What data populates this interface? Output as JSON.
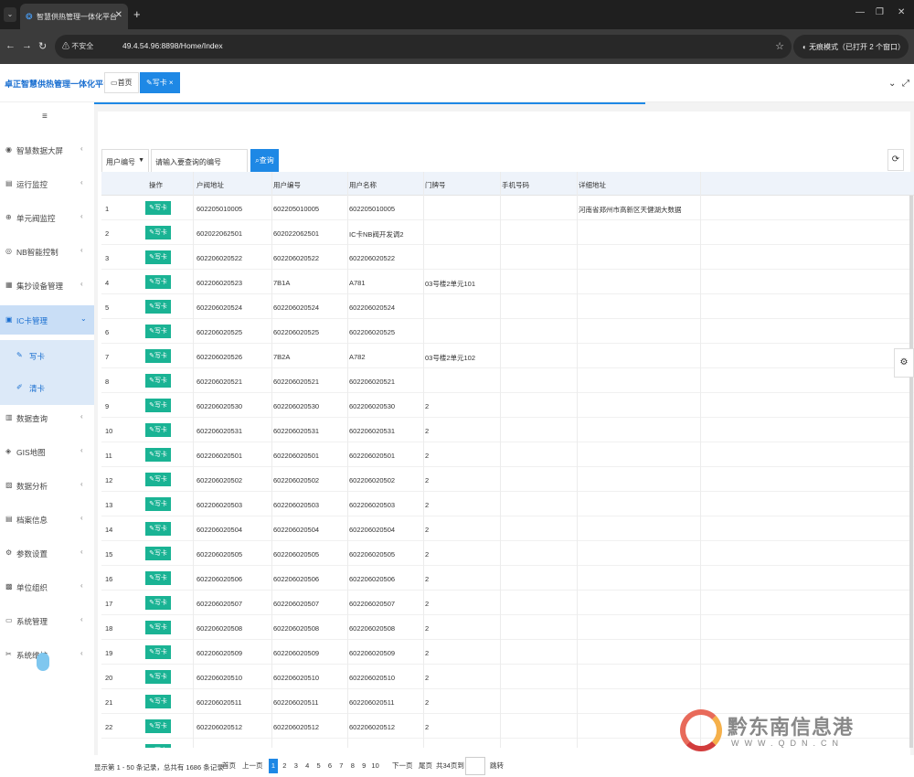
{
  "browser": {
    "tab_title": "智慧供热管理一体化平台",
    "tab_close": "✕",
    "new_tab": "+",
    "insecure_label": "不安全",
    "url": "49.4.54.96:8898/Home/Index",
    "incognito_label": "无痕模式（已打开 2 个窗口）",
    "win_min": "—",
    "win_restore": "❐",
    "win_close": "✕"
  },
  "app": {
    "brand": "卓正智慧供热管理一体化平台",
    "tabs": [
      {
        "label": "首页"
      },
      {
        "label": "写卡 ×"
      }
    ]
  },
  "sidebar": {
    "toggle": "≡",
    "items": [
      {
        "icon": "dashboard-icon",
        "glyph": "◉",
        "label": "智慧数据大屏"
      },
      {
        "icon": "monitor-icon",
        "glyph": "▤",
        "label": "运行监控"
      },
      {
        "icon": "unit-monitor-icon",
        "glyph": "⊕",
        "label": "单元阀监控"
      },
      {
        "icon": "nb-control-icon",
        "glyph": "◎",
        "label": "NB智能控制"
      },
      {
        "icon": "concentrator-icon",
        "glyph": "▦",
        "label": "集抄设备管理"
      },
      {
        "icon": "ic-card-icon",
        "glyph": "▣",
        "label": "IC卡管理"
      },
      {
        "icon": "data-query-icon",
        "glyph": "▥",
        "label": "数据查询"
      },
      {
        "icon": "gis-map-icon",
        "glyph": "◈",
        "label": "GIS地图"
      },
      {
        "icon": "data-analysis-icon",
        "glyph": "▨",
        "label": "数据分析"
      },
      {
        "icon": "archive-icon",
        "glyph": "▤",
        "label": "档案信息"
      },
      {
        "icon": "parameter-settings-icon",
        "glyph": "⚙",
        "label": "参数设置"
      },
      {
        "icon": "organization-icon",
        "glyph": "▩",
        "label": "单位组织"
      },
      {
        "icon": "system-management-icon",
        "glyph": "▭",
        "label": "系统管理"
      },
      {
        "icon": "system-maintenance-icon",
        "glyph": "✂",
        "label": "系统维护"
      }
    ],
    "sub_items": [
      {
        "icon": "write-card-icon",
        "glyph": "✎",
        "label": "写卡"
      },
      {
        "icon": "clear-card-icon",
        "glyph": "✐",
        "label": "清卡"
      }
    ]
  },
  "search": {
    "field_select": "用户编号",
    "placeholder": "请输入要查询的编号",
    "button": "查询",
    "refresh": "⟳"
  },
  "table": {
    "headers": [
      "",
      "操作",
      "户阀地址",
      "用户编号",
      "用户名称",
      "门牌号",
      "手机号码",
      "详细地址"
    ],
    "action_label": "写卡",
    "rows": [
      [
        "1",
        "602205010005",
        "602205010005",
        "602205010005",
        "",
        "",
        "河南省郑州市高新区天健湖大数据"
      ],
      [
        "2",
        "602022062501",
        "602022062501",
        "IC卡NB阀开发调2",
        "",
        "",
        ""
      ],
      [
        "3",
        "602206020522",
        "602206020522",
        "602206020522",
        "",
        "",
        ""
      ],
      [
        "4",
        "602206020523",
        "7B1A",
        "A781",
        "03号楼2单元101",
        "",
        ""
      ],
      [
        "5",
        "602206020524",
        "602206020524",
        "602206020524",
        "",
        "",
        ""
      ],
      [
        "6",
        "602206020525",
        "602206020525",
        "602206020525",
        "",
        "",
        ""
      ],
      [
        "7",
        "602206020526",
        "7B2A",
        "A782",
        "03号楼2单元102",
        "",
        ""
      ],
      [
        "8",
        "602206020521",
        "602206020521",
        "602206020521",
        "",
        "",
        ""
      ],
      [
        "9",
        "602206020530",
        "602206020530",
        "602206020530",
        "2",
        "",
        ""
      ],
      [
        "10",
        "602206020531",
        "602206020531",
        "602206020531",
        "2",
        "",
        ""
      ],
      [
        "11",
        "602206020501",
        "602206020501",
        "602206020501",
        "2",
        "",
        ""
      ],
      [
        "12",
        "602206020502",
        "602206020502",
        "602206020502",
        "2",
        "",
        ""
      ],
      [
        "13",
        "602206020503",
        "602206020503",
        "602206020503",
        "2",
        "",
        ""
      ],
      [
        "14",
        "602206020504",
        "602206020504",
        "602206020504",
        "2",
        "",
        ""
      ],
      [
        "15",
        "602206020505",
        "602206020505",
        "602206020505",
        "2",
        "",
        ""
      ],
      [
        "16",
        "602206020506",
        "602206020506",
        "602206020506",
        "2",
        "",
        ""
      ],
      [
        "17",
        "602206020507",
        "602206020507",
        "602206020507",
        "2",
        "",
        ""
      ],
      [
        "18",
        "602206020508",
        "602206020508",
        "602206020508",
        "2",
        "",
        ""
      ],
      [
        "19",
        "602206020509",
        "602206020509",
        "602206020509",
        "2",
        "",
        ""
      ],
      [
        "20",
        "602206020510",
        "602206020510",
        "602206020510",
        "2",
        "",
        ""
      ],
      [
        "21",
        "602206020511",
        "602206020511",
        "602206020511",
        "2",
        "",
        ""
      ],
      [
        "22",
        "602206020512",
        "602206020512",
        "602206020512",
        "2",
        "",
        ""
      ],
      [
        "23",
        "",
        "",
        "",
        "",
        "",
        ""
      ]
    ]
  },
  "pager": {
    "info": "显示第 1 - 50 条记录，总共有 1686 条记录",
    "first": "首页",
    "prev": "上一页",
    "pages": [
      "1",
      "2",
      "3",
      "4",
      "5",
      "6",
      "7",
      "8",
      "9",
      "10"
    ],
    "current": "1",
    "next": "下一页",
    "last": "尾页",
    "total": "共34页到",
    "go": "跳转"
  },
  "watermark": {
    "text": "黔东南信息港",
    "sub": "WWW.QDN.CN"
  }
}
